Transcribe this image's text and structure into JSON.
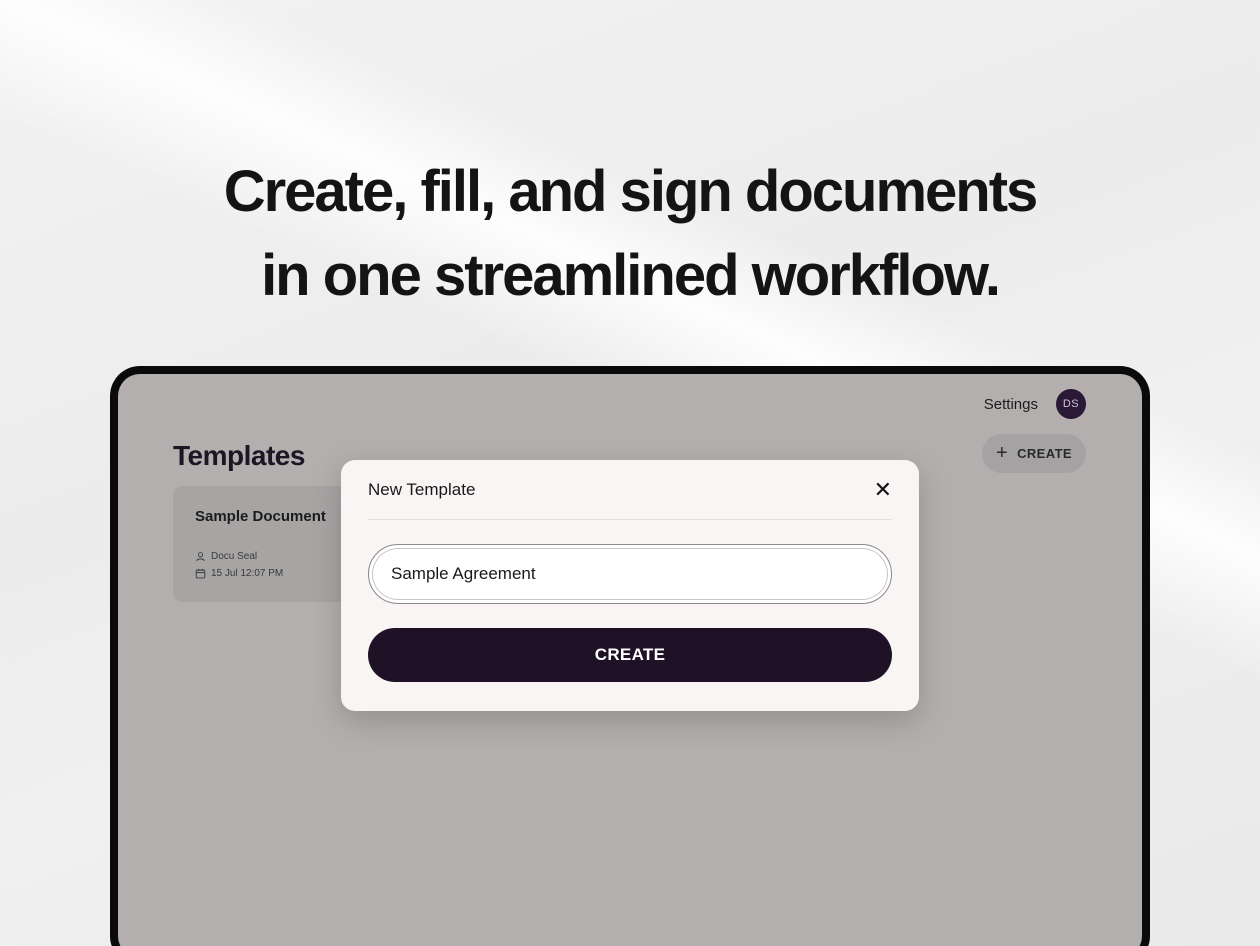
{
  "headline": {
    "line1": "Create, fill, and sign documents",
    "line2": "in one streamlined workflow."
  },
  "nav": {
    "settings_label": "Settings",
    "avatar_initials": "DS"
  },
  "page": {
    "title": "Templates",
    "create_label": "CREATE"
  },
  "templates": [
    {
      "title": "Sample Document",
      "author": "Docu Seal",
      "date": "15 Jul 12:07 PM"
    }
  ],
  "modal": {
    "title": "New Template",
    "input_value": "Sample Agreement",
    "submit_label": "CREATE"
  },
  "colors": {
    "accent": "#1f1227",
    "avatar_bg": "#2b1736",
    "overlay": "#b2afae"
  }
}
